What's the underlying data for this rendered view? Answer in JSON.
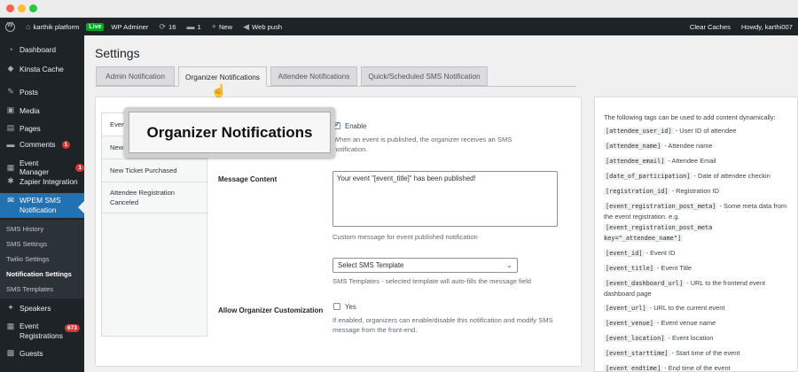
{
  "admin_bar": {
    "site_name": "karthik platform",
    "live_label": "Live",
    "wp_admin": "WP Adminer",
    "updates_count": "16",
    "comments_count": "1",
    "new_label": "New",
    "web_push": "Web push",
    "clear_caches": "Clear Caches",
    "howdy": "Howdy, karthi007"
  },
  "sidebar": {
    "items": [
      {
        "label": "Dashboard",
        "icon": "dashboard-icon"
      },
      {
        "label": "Kinsta Cache",
        "icon": "kinsta-icon"
      },
      {
        "label": "Posts",
        "icon": "pin-icon"
      },
      {
        "label": "Media",
        "icon": "media-icon"
      },
      {
        "label": "Pages",
        "icon": "pages-icon"
      },
      {
        "label": "Comments",
        "icon": "comments-icon",
        "badge": "1"
      },
      {
        "label": "Event Manager",
        "icon": "calendar-icon",
        "badge": "1"
      },
      {
        "label": "Zapier Integration",
        "icon": "zapier-icon"
      },
      {
        "label": "WPEM SMS Notification",
        "icon": "mail-icon"
      },
      {
        "label": "Speakers",
        "icon": "speakers-icon"
      },
      {
        "label": "Event Registrations",
        "icon": "registrations-icon",
        "badge": "673"
      },
      {
        "label": "Guests",
        "icon": "guests-icon"
      }
    ],
    "submenu": [
      "SMS History",
      "SMS Settings",
      "Twilio Settings",
      "Notification Settings",
      "SMS Templates"
    ]
  },
  "page": {
    "title": "Settings",
    "tabs": [
      "Admin Notification",
      "Organizer Notifications",
      "Attendee Notifications",
      "Quick/Scheduled SMS Notification"
    ],
    "active_tab": "Organizer Notifications"
  },
  "vertical_tabs": [
    "Even",
    "New",
    "New Ticket Purchased",
    "Attendee Registration Canceled"
  ],
  "form": {
    "enable_label": "Enable",
    "enable_desc": "When an event is published, the organizer receives an SMS notification.",
    "message_content_label": "Message Content",
    "message_value": "Your event \"[event_title]\" has been published!",
    "message_desc": "Custom message for event published notification",
    "template_selected": "Select SMS Template",
    "template_desc": "SMS Templates - selected template will auto-fills the message field",
    "allow_label": "Allow Organizer Customization",
    "yes_label": "Yes",
    "allow_desc": "If enabled, organizers can enable/disable this notification and modify SMS message from the front-end."
  },
  "callout": {
    "text": "Organizer Notifications"
  },
  "tags_help": {
    "intro": "The following tags can be used to add content dynamically:",
    "tags": [
      {
        "code": "[attendee_user_id]",
        "desc": "- User ID of attendee"
      },
      {
        "code": "[attendee_name]",
        "desc": "- Attendee name"
      },
      {
        "code": "[attendee_email]",
        "desc": "- Attendee Email"
      },
      {
        "code": "[date_of_participation]",
        "desc": "- Date of attendee checkin"
      },
      {
        "code": "[registration_id]",
        "desc": "- Registration ID"
      },
      {
        "code": "[event_registration_post_meta]",
        "desc": "- Some meta data from the event registration. e.g."
      },
      {
        "code": "[event_registration_post_meta key=\"_attendee_name\"]",
        "desc": ""
      },
      {
        "code": "[event_id]",
        "desc": "- Event ID"
      },
      {
        "code": "[event_title]",
        "desc": "- Event Title"
      },
      {
        "code": "[event_dashboard_url]",
        "desc": "- URL to the frontend event dashboard page"
      },
      {
        "code": "[event_url]",
        "desc": "- URL to the current event"
      },
      {
        "code": "[event_venue]",
        "desc": "- Event venue name"
      },
      {
        "code": "[event_location]",
        "desc": "- Event location"
      },
      {
        "code": "[event_starttime]",
        "desc": "- Start time of the event"
      },
      {
        "code": "[event_endtime]",
        "desc": "- End time of the event"
      }
    ]
  }
}
